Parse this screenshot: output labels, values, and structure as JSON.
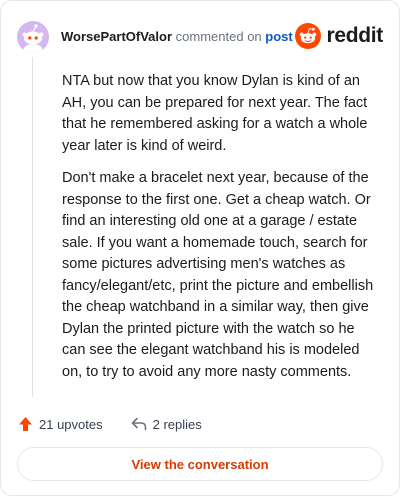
{
  "comment": {
    "username": "WorsePartOfValor",
    "action_text": "commented on",
    "target_link": "post",
    "paragraphs": [
      "NTA but now that you know Dylan is kind of an AH, you can be prepared for next year. The fact that he remembered asking for a watch a whole year later is kind of weird.",
      "Don't make a bracelet next year, because of the response to the first one. Get a cheap watch. Or find an interesting old one at a garage / estate sale. If you want a homemade touch, search for some pictures advertising men's watches as fancy/elegant/etc, print the picture and embellish the cheap watchband in a similar way, then give Dylan the printed picture with the watch so he can see the elegant watchband his is modeled on, to try to avoid any more nasty comments."
    ]
  },
  "brand": {
    "name": "reddit",
    "logo_icon": "reddit-snoo-icon",
    "accent": "#ff4500"
  },
  "footer": {
    "upvotes_label": "21 upvotes",
    "replies_label": "2 replies",
    "upvote_icon": "upvote-arrow-icon",
    "reply_icon": "reply-arrow-icon",
    "upvote_color": "#ff4500"
  },
  "cta": {
    "label": "View the conversation",
    "color": "#d93a00"
  },
  "avatar": {
    "icon": "snoo-avatar-icon",
    "background": "#d4b8ef"
  }
}
